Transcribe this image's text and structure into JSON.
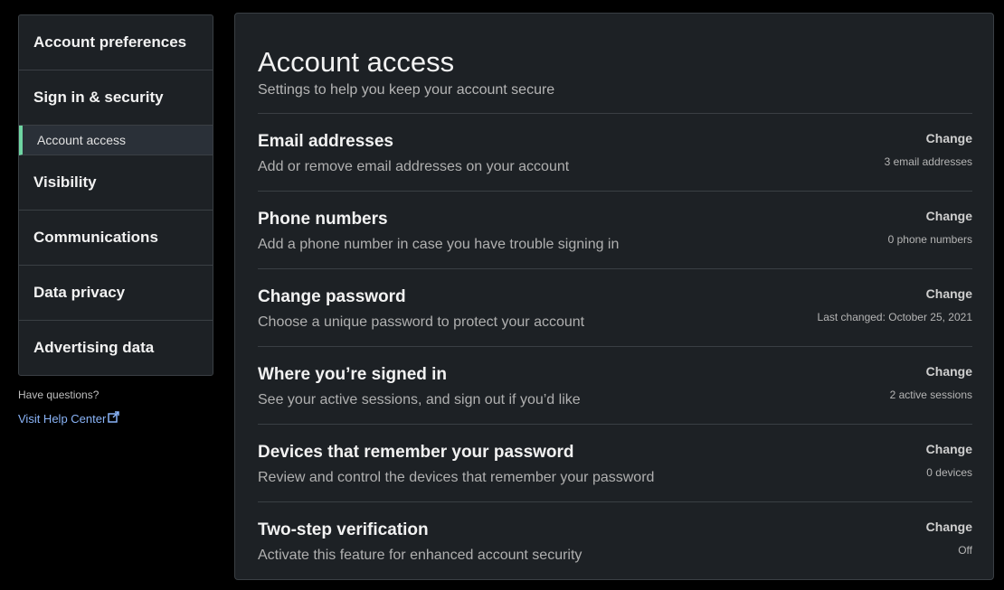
{
  "sidebar": {
    "items": [
      {
        "label": "Account preferences"
      },
      {
        "label": "Sign in & security"
      },
      {
        "label": "Visibility"
      },
      {
        "label": "Communications"
      },
      {
        "label": "Data privacy"
      },
      {
        "label": "Advertising data"
      }
    ],
    "sub_item": "Account access",
    "accent_color": "#6fd5a3"
  },
  "help": {
    "question": "Have questions?",
    "link_label": "Visit Help Center",
    "link_icon": "external-link-icon"
  },
  "main": {
    "title": "Account access",
    "subtitle": "Settings to help you keep your account secure",
    "rows": [
      {
        "title": "Email addresses",
        "desc": "Add or remove email addresses on your account",
        "action": "Change",
        "status": "3 email addresses"
      },
      {
        "title": "Phone numbers",
        "desc": "Add a phone number in case you have trouble signing in",
        "action": "Change",
        "status": "0 phone numbers"
      },
      {
        "title": "Change password",
        "desc": "Choose a unique password to protect your account",
        "action": "Change",
        "status": "Last changed: October 25, 2021"
      },
      {
        "title": "Where you’re signed in",
        "desc": "See your active sessions, and sign out if you’d like",
        "action": "Change",
        "status": "2 active sessions"
      },
      {
        "title": "Devices that remember your password",
        "desc": "Review and control the devices that remember your password",
        "action": "Change",
        "status": "0 devices"
      },
      {
        "title": "Two-step verification",
        "desc": "Activate this feature for enhanced account security",
        "action": "Change",
        "status": "Off"
      }
    ]
  }
}
